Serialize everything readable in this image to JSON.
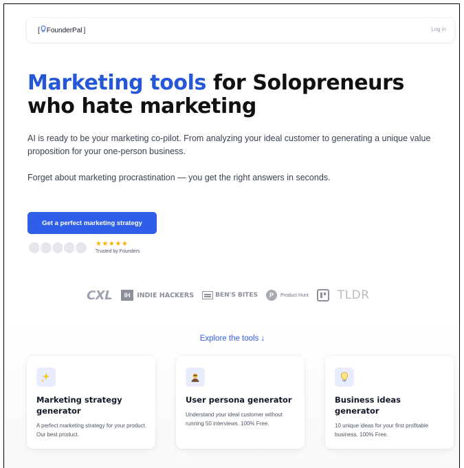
{
  "nav": {
    "brand_left": "[",
    "brand_name": "FounderPal",
    "brand_right": "]",
    "login": "Log in"
  },
  "hero": {
    "title_accent": "Marketing tools",
    "title_rest": " for Solopreneurs who hate marketing",
    "lead": "AI is ready to be your marketing co-pilot. From analyzing your ideal customer to generating a unique value proposition for your one-person business.",
    "lead2": "Forget about marketing procrastination — you get the right answers in seconds.",
    "cta": "Get a perfect marketing strategy",
    "stars": "★★★★★",
    "rating": 5,
    "trusted": "Trusted by Founders"
  },
  "logos": {
    "cxl": "CXL",
    "ih_mark": "IH",
    "ih": "INDIE HACKERS",
    "bb": "BEN'S BITES",
    "ph_mark": "P",
    "ph": "Product Hunt",
    "tldr": "TLDR"
  },
  "explore": "Explore the tools ↓",
  "cards": [
    {
      "icon": "sparkles-icon",
      "title": "Marketing strategy generator",
      "desc": "A perfect marketing strategy for your product. Our best product."
    },
    {
      "icon": "persona-icon",
      "title": "User persona generator",
      "desc": "Understand your ideal customer without running 50 interviews. 100% Free."
    },
    {
      "icon": "lightbulb-icon",
      "title": "Business ideas generator",
      "desc": "10 unique ideas for your first profitable business. 100% Free."
    }
  ],
  "colors": {
    "accent": "#2557d6",
    "button": "#2f5fe8",
    "star": "#f5b301"
  }
}
